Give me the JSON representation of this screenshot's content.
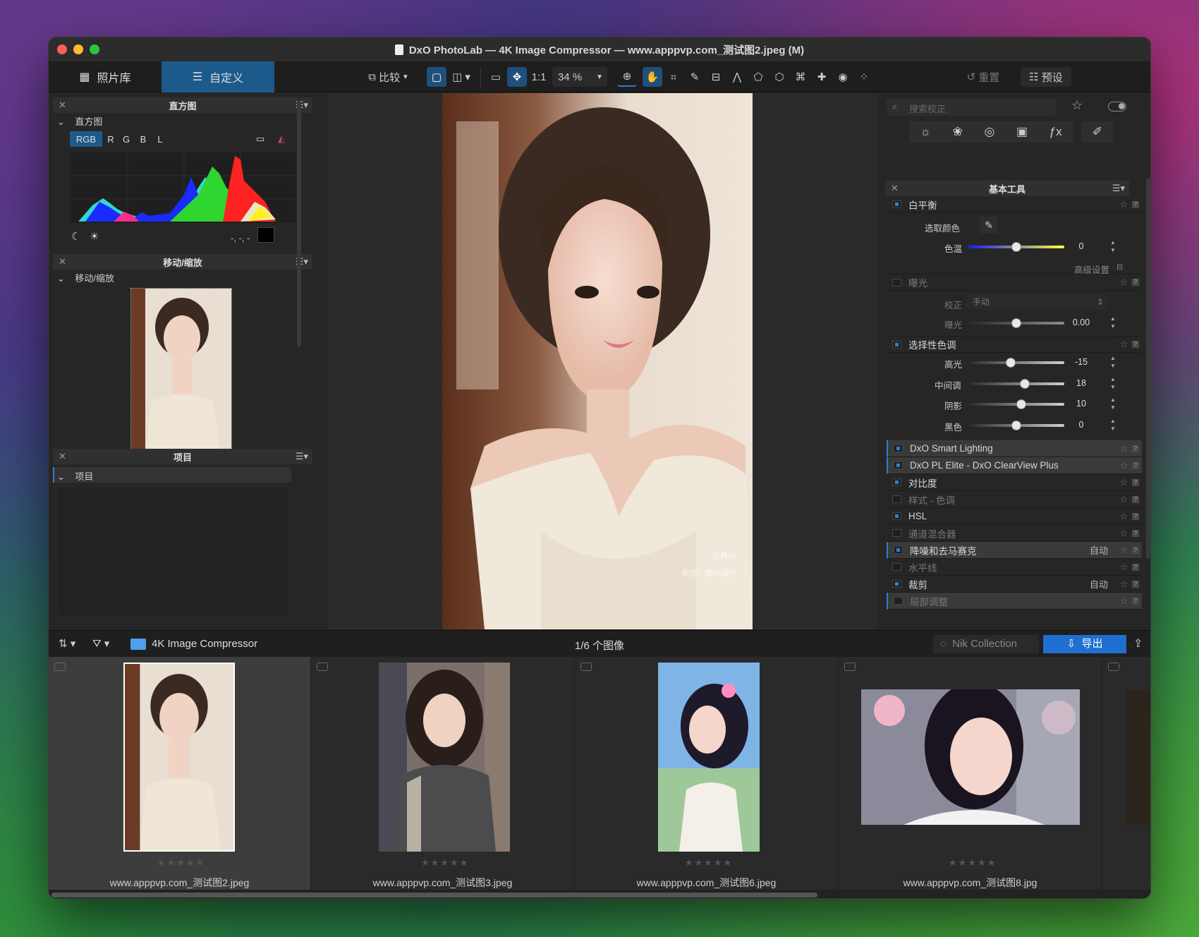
{
  "window": {
    "title": "DxO PhotoLab — 4K Image Compressor — www.apppvp.com_测试图2.jpeg (M)"
  },
  "tabs": {
    "library": "照片库",
    "customize": "自定义"
  },
  "toolbar": {
    "compare": "比较",
    "one_to_one": "1:1",
    "zoom": "34 %",
    "reset": "重置",
    "presets": "预设"
  },
  "histogram": {
    "title": "直方图",
    "section": "直方图",
    "channels": [
      "RGB",
      "R",
      "G",
      "B",
      "L"
    ],
    "readout": "-, -, -"
  },
  "move_zoom": {
    "title": "移动/缩放",
    "section": "移动/缩放"
  },
  "project": {
    "title": "项目",
    "section": "项目"
  },
  "right": {
    "search_placeholder": "搜索校正",
    "panel_title": "基本工具",
    "wb": {
      "label": "白平衡",
      "pick": "选取颜色",
      "temp": "色温",
      "temp_val": "0",
      "advanced": "高级设置"
    },
    "exposure": {
      "label": "曝光",
      "correct": "校正",
      "mode": "手动",
      "exp": "曝光",
      "exp_val": "0.00"
    },
    "tone": {
      "label": "选择性色调",
      "items": [
        {
          "name": "高光",
          "value": "-15",
          "pos": 0.44
        },
        {
          "name": "中间调",
          "value": "18",
          "pos": 0.59
        },
        {
          "name": "阴影",
          "value": "10",
          "pos": 0.55
        },
        {
          "name": "黑色",
          "value": "0",
          "pos": 0.5
        }
      ]
    },
    "tools": [
      {
        "name": "DxO Smart Lighting",
        "on": true,
        "dim": false,
        "hi": true,
        "auto": ""
      },
      {
        "name": "DxO PL Elite - DxO ClearView Plus",
        "on": true,
        "dim": false,
        "hi": true,
        "auto": ""
      },
      {
        "name": "对比度",
        "on": true,
        "dim": false,
        "hi": false,
        "auto": ""
      },
      {
        "name": "样式 - 色调",
        "on": false,
        "dim": true,
        "hi": false,
        "auto": ""
      },
      {
        "name": "HSL",
        "on": true,
        "dim": false,
        "hi": false,
        "auto": ""
      },
      {
        "name": "通道混合器",
        "on": false,
        "dim": true,
        "hi": false,
        "auto": ""
      },
      {
        "name": "降噪和去马赛克",
        "on": true,
        "dim": false,
        "hi": true,
        "auto": "自动"
      },
      {
        "name": "水平线",
        "on": false,
        "dim": true,
        "hi": false,
        "auto": ""
      },
      {
        "name": "裁剪",
        "on": true,
        "dim": false,
        "hi": false,
        "auto": "自动"
      },
      {
        "name": "局部调整",
        "on": false,
        "dim": true,
        "hi": true,
        "auto": ""
      }
    ]
  },
  "filmstrip": {
    "folder": "4K Image Compressor",
    "count": "1/6 个图像",
    "nik": "Nik Collection",
    "export": "导出",
    "items": [
      "www.apppvp.com_测试图2.jpeg",
      "www.apppvp.com_测试图3.jpeg",
      "www.apppvp.com_测试图6.jpeg",
      "www.apppvp.com_测试图8.jpg"
    ]
  },
  "watermark": {
    "logo": "元界AI",
    "caption": "昵称：御风而行"
  },
  "colors": {
    "accent": "#1d5a8c",
    "export": "#1f6fd1"
  }
}
